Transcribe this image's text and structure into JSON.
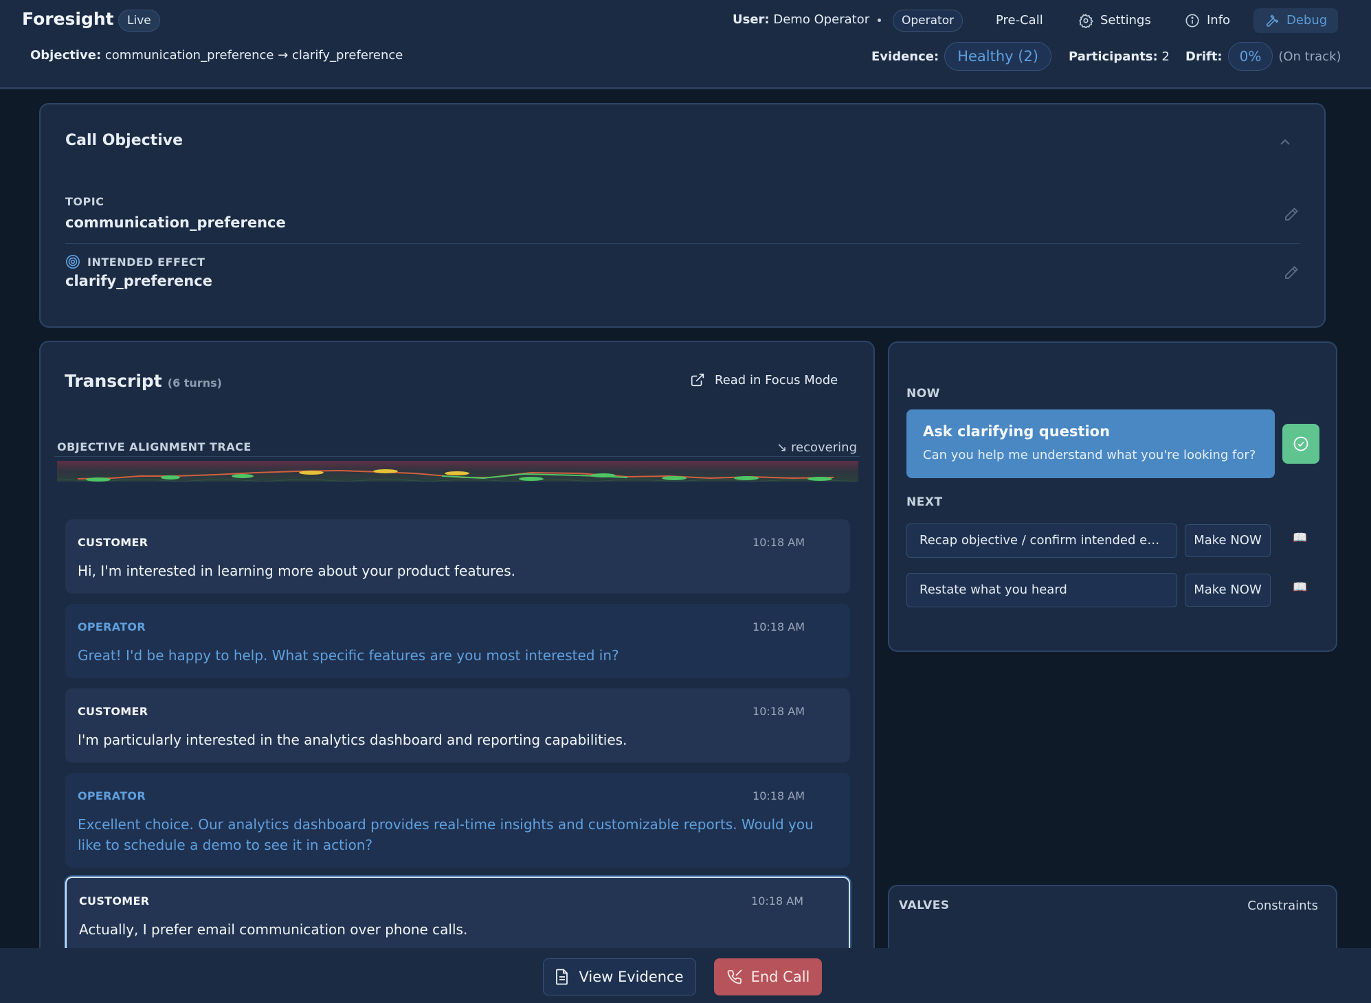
{
  "header": {
    "brand": "Foresight",
    "live_badge": "Live",
    "user_label": "User:",
    "user_name": "Demo Operator",
    "role": "Operator",
    "nav": {
      "precall": "Pre-Call",
      "settings": "Settings",
      "info": "Info",
      "debug": "Debug"
    },
    "objective_label": "Objective:",
    "objective_value": "communication_preference → clarify_preference",
    "evidence_label": "Evidence:",
    "evidence_value": "Healthy (2)",
    "participants_label": "Participants:",
    "participants_value": "2",
    "drift_label": "Drift:",
    "drift_value": "0%",
    "drift_status": "(On track)"
  },
  "call_objective": {
    "title": "Call Objective",
    "topic_label": "TOPIC",
    "topic_value": "communication_preference",
    "effect_label": "INTENDED EFFECT",
    "effect_value": "clarify_preference"
  },
  "transcript": {
    "title": "Transcript",
    "turns": "(6 turns)",
    "focus_label": "Read in Focus Mode",
    "trace_label": "OBJECTIVE ALIGNMENT TRACE",
    "trace_status": "↘ recovering",
    "messages": [
      {
        "role": "CUSTOMER",
        "time": "10:18 AM",
        "text": "Hi, I'm interested in learning more about your product features."
      },
      {
        "role": "OPERATOR",
        "time": "10:18 AM",
        "text": "Great! I'd be happy to help. What specific features are you most interested in?"
      },
      {
        "role": "CUSTOMER",
        "time": "10:18 AM",
        "text": "I'm particularly interested in the analytics dashboard and reporting capabilities."
      },
      {
        "role": "OPERATOR",
        "time": "10:18 AM",
        "text": "Excellent choice. Our analytics dashboard provides real-time insights and customizable reports. Would you like to schedule a demo to see it in action?"
      },
      {
        "role": "CUSTOMER",
        "time": "10:18 AM",
        "text": "Actually, I prefer email communication over phone calls."
      }
    ]
  },
  "actions": {
    "now_label": "NOW",
    "now_title": "Ask clarifying question",
    "now_sub": "Can you help me understand what you're looking for?",
    "next_label": "NEXT",
    "next_items": [
      {
        "label": "Recap objective / confirm intended effect",
        "action": "Make NOW"
      },
      {
        "label": "Restate what you heard",
        "action": "Make NOW"
      }
    ]
  },
  "valves": {
    "label": "VALVES",
    "constraints": "Constraints"
  },
  "footer": {
    "view_evidence": "View Evidence",
    "end_call": "End Call"
  },
  "colors": {
    "accent": "#5fa0de",
    "success": "#5fc490",
    "danger": "#b7535a"
  }
}
